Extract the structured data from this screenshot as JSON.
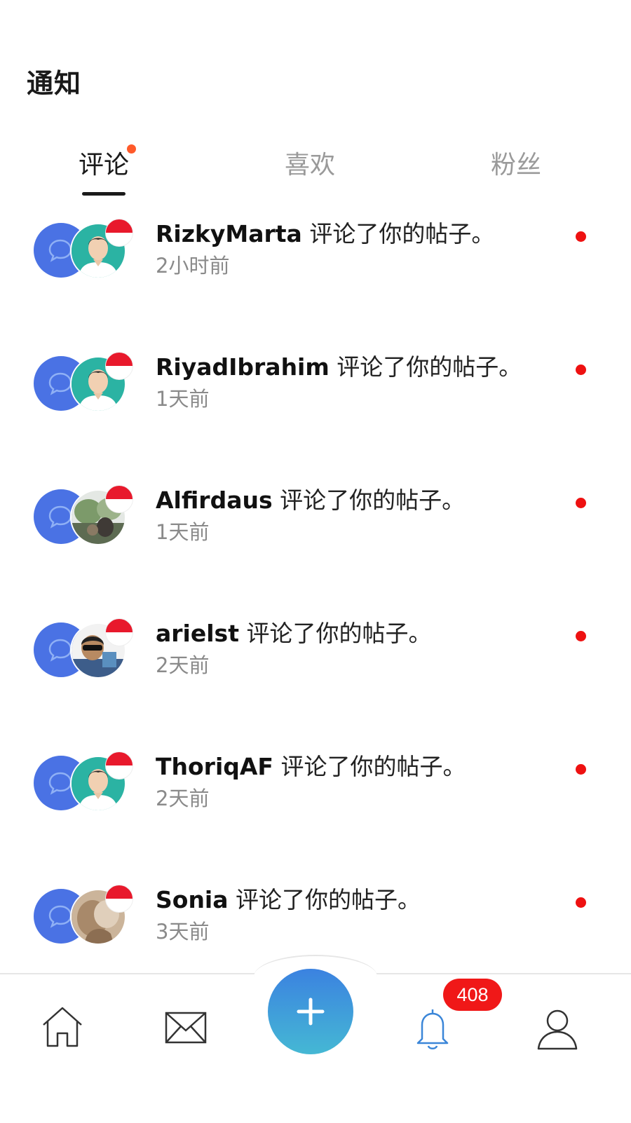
{
  "header": {
    "title": "通知"
  },
  "tabs": [
    {
      "label": "评论",
      "active": true,
      "has_dot": true
    },
    {
      "label": "喜欢",
      "active": false,
      "has_dot": false
    },
    {
      "label": "粉丝",
      "active": false,
      "has_dot": false
    }
  ],
  "notifications": [
    {
      "username": "RizkyMarta",
      "action": "评论了你的帖子。",
      "time": "2小时前",
      "avatar": "default-avatar-icon",
      "unread": true
    },
    {
      "username": "RiyadIbrahim",
      "action": "评论了你的帖子。",
      "time": "1天前",
      "avatar": "default-avatar-icon",
      "unread": true
    },
    {
      "username": "Alfirdaus",
      "action": "评论了你的帖子。",
      "time": "1天前",
      "avatar": "photo-avatar",
      "unread": true
    },
    {
      "username": "arielst",
      "action": "评论了你的帖子。",
      "time": "2天前",
      "avatar": "photo-avatar",
      "unread": true
    },
    {
      "username": "ThoriqAF",
      "action": "评论了你的帖子。",
      "time": "2天前",
      "avatar": "default-avatar-icon",
      "unread": true
    },
    {
      "username": "Sonia",
      "action": "评论了你的帖子。",
      "time": "3天前",
      "avatar": "photo-avatar",
      "unread": true
    }
  ],
  "bottom_nav": {
    "items": [
      "home-icon",
      "mail-icon",
      "add-icon",
      "bell-icon",
      "profile-icon"
    ],
    "badge": "408",
    "active": "bell-icon"
  },
  "colors": {
    "accent": "#4a72e4",
    "unread": "#ee1111",
    "tab_dot": "#ff5a2a",
    "fab_top": "#3b82e0",
    "fab_bottom": "#45b8d4"
  }
}
